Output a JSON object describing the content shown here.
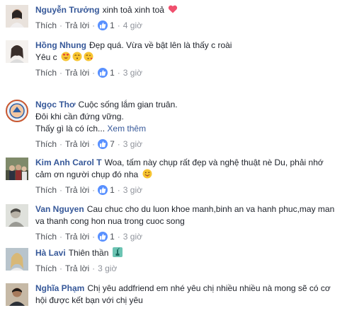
{
  "action_labels": {
    "like": "Thích",
    "reply": "Trả lời",
    "separator": "·"
  },
  "comments": [
    {
      "author": "Nguyễn Trưởng",
      "lines": [
        "xinh toả xinh toả"
      ],
      "emoji": [
        "heart"
      ],
      "likes": "1",
      "time": "4 giờ",
      "avatar": "avatar-woman-light"
    },
    {
      "author": "Hồng Nhung",
      "lines": [
        "Đẹp quá. Vừa về bật lên là thấy c roài",
        "Yêu c"
      ],
      "emoji": [
        "heart-eyes",
        "kissing",
        "kissing-heart"
      ],
      "likes": "1",
      "time": "3 giờ",
      "avatar": "avatar-woman-portrait"
    },
    {
      "author": "Ngọc Thơ",
      "lines": [
        "Cuộc sống lắm gian truân.",
        "Đôi khi cần đứng vững.",
        "Thấy gì là có ích..."
      ],
      "see_more": "Xem thêm",
      "likes": "7",
      "time": "3 giờ",
      "avatar": "avatar-emblem"
    },
    {
      "author": "Kim Anh Carol T",
      "lines": [
        "Woa, tấm này chụp rất đẹp và nghệ thuật nè Du, phải nhớ",
        "cảm ơn người chụp đó nha"
      ],
      "emoji": [
        "tongue-wink"
      ],
      "likes": "1",
      "time": "3 giờ",
      "avatar": "avatar-group"
    },
    {
      "author": "Van Nguyen",
      "lines": [
        "Cau chuc cho du luon khoe manh,binh an va hanh phuc,may man",
        "va thanh cong hon nua trong cuoc song"
      ],
      "likes": "1",
      "time": "3 giờ",
      "avatar": "avatar-man-gray"
    },
    {
      "author": "Hà Lavi",
      "lines": [
        "Thiên thần"
      ],
      "emoji": [
        "statue-of-liberty"
      ],
      "likes": "",
      "time": "3 giờ",
      "avatar": "avatar-woman-blonde"
    },
    {
      "author": "Nghĩa Phạm",
      "lines": [
        "Chị yêu addfriend em nhé yêu chị nhiều nhiều nà mong sẽ có cơ",
        "hội được kết bạn với chị yêu"
      ],
      "likes": "",
      "time": "",
      "avatar": "avatar-man-dark"
    }
  ],
  "colors": {
    "author": "#365899",
    "text": "#1d2129",
    "meta": "#90949c",
    "like_badge": "#5890ff"
  }
}
